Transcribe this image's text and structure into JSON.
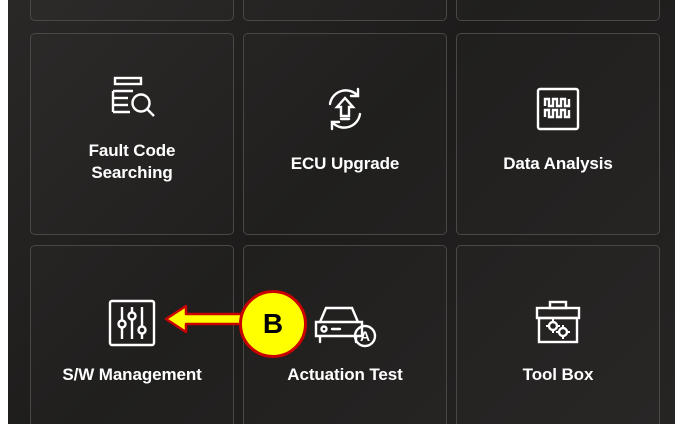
{
  "menu": {
    "tiles": [
      {
        "label": "Fault Code\nSearching",
        "icon": "fault-code-search-icon"
      },
      {
        "label": "ECU Upgrade",
        "icon": "ecu-upgrade-icon"
      },
      {
        "label": "Data Analysis",
        "icon": "data-analysis-icon"
      },
      {
        "label": "S/W Management",
        "icon": "sw-management-icon"
      },
      {
        "label": "Actuation Test",
        "icon": "actuation-test-icon"
      },
      {
        "label": "Tool Box",
        "icon": "tool-box-icon"
      }
    ]
  },
  "annotation": {
    "badge_label": "B",
    "badge_fill": "#ffff00",
    "badge_border": "#c80000",
    "arrow_color": "#ffff00"
  }
}
